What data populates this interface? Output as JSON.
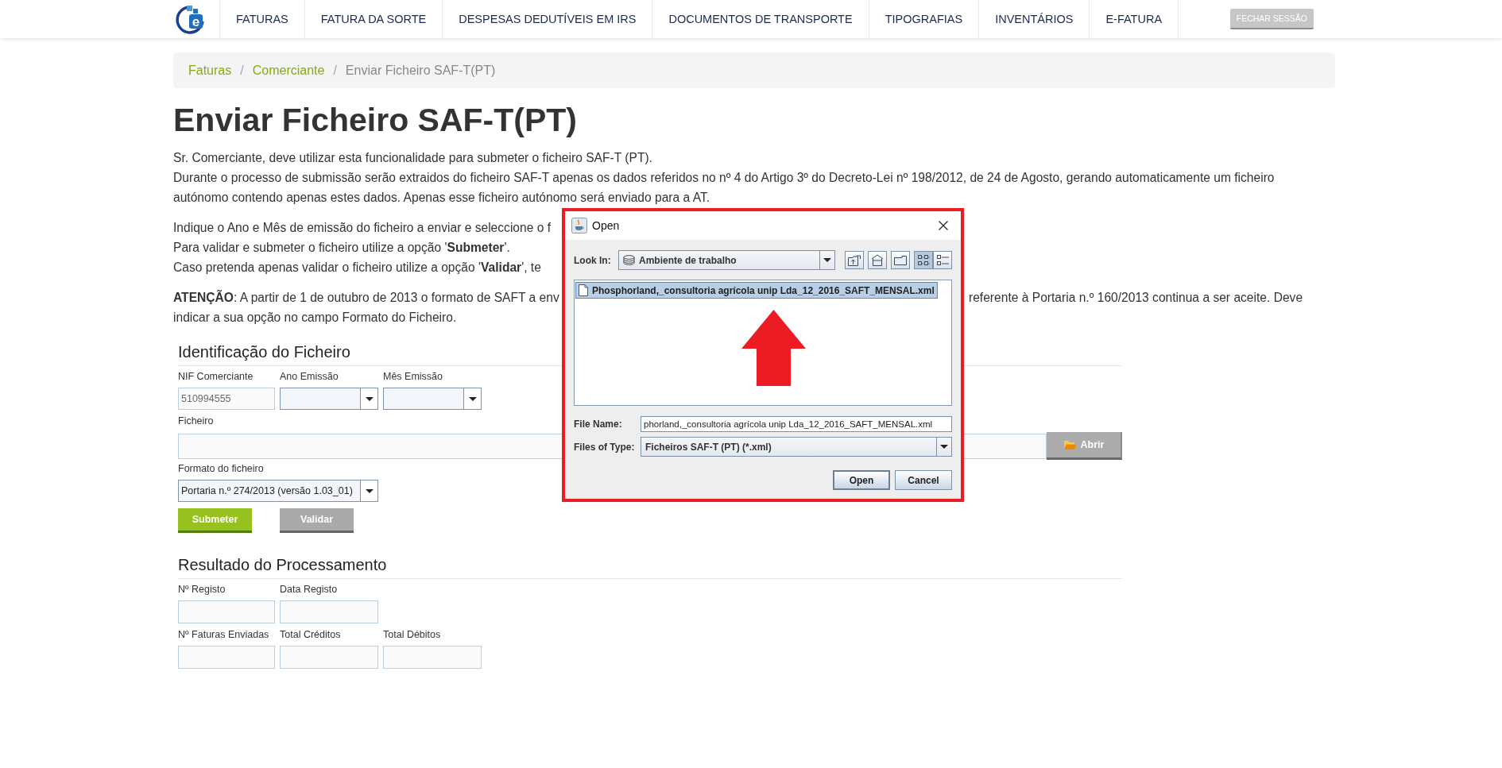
{
  "nav": {
    "logo_text": "e",
    "items": [
      {
        "label": "FATURAS"
      },
      {
        "label": "FATURA DA SORTE"
      },
      {
        "label": "DESPESAS DEDUTÍVEIS EM IRS"
      },
      {
        "label": "DOCUMENTOS DE TRANSPORTE"
      },
      {
        "label": "TIPOGRAFIAS"
      },
      {
        "label": "INVENTÁRIOS"
      },
      {
        "label": "E-FATURA"
      }
    ],
    "logout": "FECHAR SESSÃO"
  },
  "breadcrumb": [
    {
      "label": "Faturas",
      "kind": "link"
    },
    {
      "label": "Comerciante",
      "kind": "link",
      "separator": "/"
    },
    {
      "label": "Enviar Ficheiro SAF-T(PT)",
      "kind": "current",
      "separator": "/"
    }
  ],
  "title": "Enviar Ficheiro SAF-T(PT)",
  "intro": [
    {
      "lines": [
        {
          "text": "Sr. Comerciante, deve utilizar esta funcionalidade para submeter o ficheiro SAF-T (PT)."
        },
        {
          "text": "Durante o processo de submissão serão extraidos do ficheiro SAF-T apenas os dados referidos no nº 4 do Artigo 3º do Decreto-Lei nº 198/2012, de 24 de Agosto, gerando automaticamente um ficheiro autónomo contendo apenas estes dados. Apenas esse ficheiro autónomo será enviado para a AT."
        }
      ]
    },
    {
      "lines": [
        {
          "text": "Indique o Ano e Mês de emissão do ficheiro a enviar e seleccione o f"
        },
        {
          "text": "Para validar e submeter o ficheiro utilize a opção '**Submeter**'."
        },
        {
          "text": "Caso pretenda apenas validar o ficheiro utilize a opção '**Validar**', te"
        }
      ]
    },
    {
      "lines": [
        {
          "text": "**ATENÇÃO**: A partir de 1 de outubro de 2013 o formato de SAFT a env",
          "continuation": "referente à Portaria n.º 160/2013 continua a ser aceite. Deve"
        },
        {
          "text": "indicar a sua opção no campo Formato do Ficheiro."
        }
      ]
    }
  ],
  "identification": {
    "heading": "Identificação do Ficheiro",
    "fields": [
      {
        "kind": "text",
        "label": "NIF Comerciante",
        "value": "510994555"
      },
      {
        "kind": "select",
        "label": "Ano Emissão"
      },
      {
        "kind": "select",
        "label": "Mês Emissão"
      }
    ],
    "file": {
      "label": "Ficheiro",
      "button": "Abrir"
    },
    "format": {
      "label": "Formato do ficheiro",
      "value": "Portaria n.º 274/2013 (versão 1.03_01)"
    },
    "actions": [
      {
        "label": "Submeter",
        "kind": "primary"
      },
      {
        "label": "Validar",
        "kind": "secondary"
      }
    ]
  },
  "result": {
    "heading": "Resultado do Processamento",
    "rows": [
      [
        {
          "label": "Nº Registo"
        },
        {
          "label": "Data Registo"
        }
      ],
      [
        {
          "label": "Nº Faturas Enviadas"
        },
        {
          "label": "Total Créditos"
        },
        {
          "label": "Total Débitos"
        }
      ]
    ]
  },
  "dialog": {
    "title": "Open",
    "look_in": {
      "label": "Look In:",
      "value": "Ambiente de trabalho"
    },
    "toolbar": [
      {
        "kind": "up"
      },
      {
        "kind": "home"
      },
      {
        "kind": "new_folder"
      }
    ],
    "view_modes": [
      {
        "kind": "list",
        "selected": true
      },
      {
        "kind": "details",
        "selected": false
      }
    ],
    "files": [
      {
        "name": "Phosphorland,_consultoria agrícola unip Lda_12_2016_SAFT_MENSAL.xml",
        "selected": true
      }
    ],
    "file_name": {
      "label": "File Name:",
      "value": "phorland,_consultoria agrícola unip Lda_12_2016_SAFT_MENSAL.xml"
    },
    "file_type": {
      "label": "Files of Type:",
      "value": "Ficheiros SAF-T (PT) (*.xml)"
    },
    "buttons": [
      {
        "label": "Open",
        "kind": "default"
      },
      {
        "label": "Cancel",
        "kind": "normal"
      }
    ]
  }
}
